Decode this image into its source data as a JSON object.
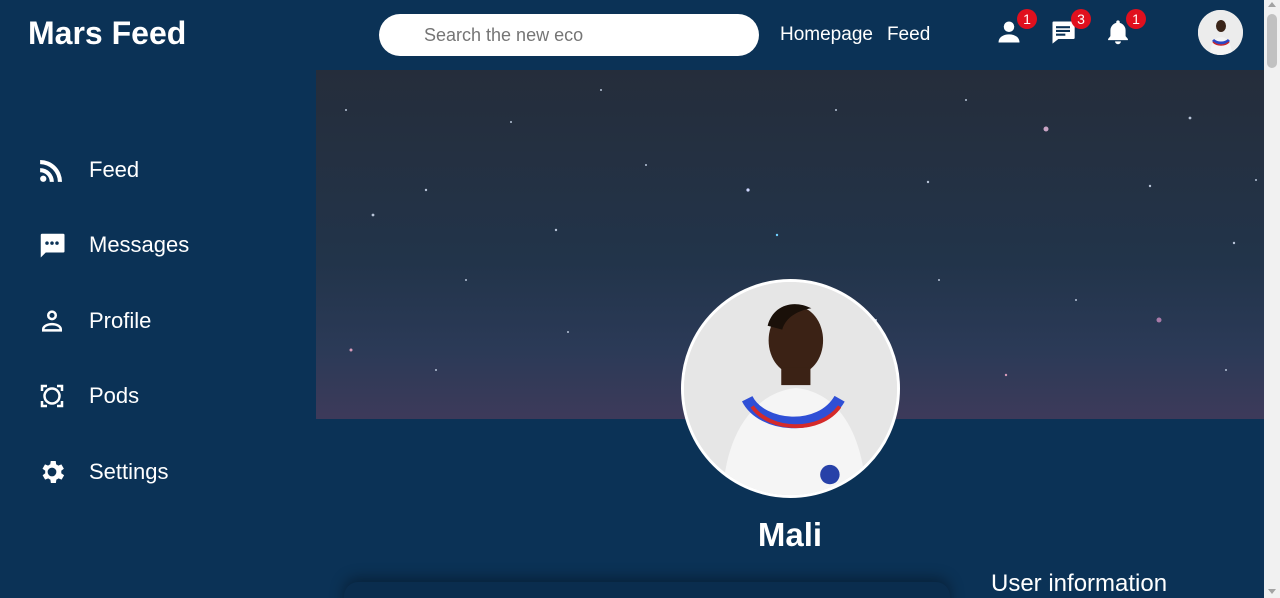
{
  "header": {
    "logo": "Mars Feed",
    "search": {
      "placeholder": "Search the new eco",
      "value": ""
    },
    "nav_links": [
      "Homepage",
      "Feed"
    ],
    "badges": {
      "friends": "1",
      "messages": "3",
      "notifications": "1"
    }
  },
  "sidebar": {
    "items": [
      {
        "label": "Feed",
        "icon": "rss-icon"
      },
      {
        "label": "Messages",
        "icon": "chat-icon"
      },
      {
        "label": "Profile",
        "icon": "person-icon"
      },
      {
        "label": "Pods",
        "icon": "pods-icon"
      },
      {
        "label": "Settings",
        "icon": "gear-icon"
      }
    ]
  },
  "profile": {
    "name": "Mali",
    "user_info_title": "User information"
  },
  "colors": {
    "background": "#0b3256",
    "badge": "#e0101e",
    "text": "#ffffff"
  }
}
